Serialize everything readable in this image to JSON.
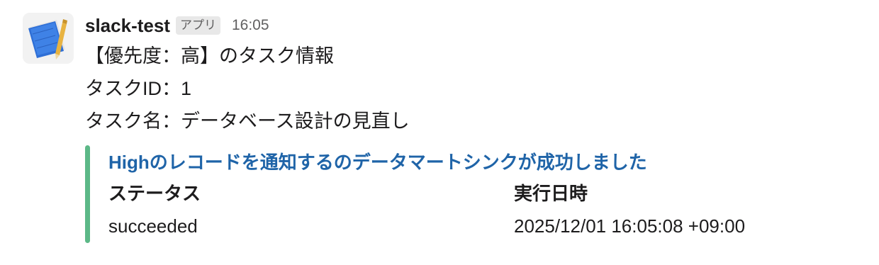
{
  "message": {
    "sender": "slack-test",
    "badge": "アプリ",
    "time": "16:05",
    "lines": [
      "【優先度：高】のタスク情報",
      "タスクID：1",
      "タスク名：データベース設計の見直し"
    ]
  },
  "attachment": {
    "color": "#5cb887",
    "title": "Highのレコードを通知するのデータマートシンクが成功しました",
    "fields": [
      {
        "title": "ステータス",
        "value": "succeeded"
      },
      {
        "title": "実行日時",
        "value": "2025/12/01 16:05:08 +09:00"
      }
    ]
  },
  "avatar_icon": "notebook-pencil-icon"
}
